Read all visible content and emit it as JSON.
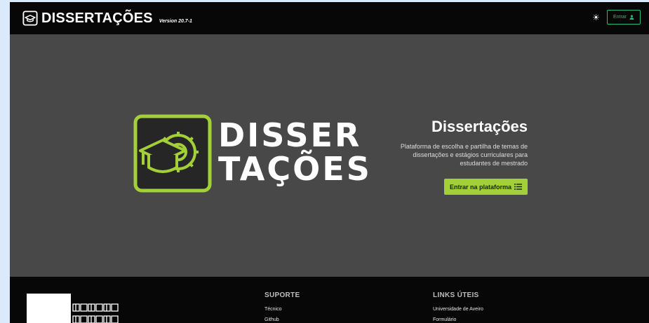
{
  "header": {
    "brand_title": "DISSERTAÇÕES",
    "version": "Version 20.7-1",
    "theme_toggle_icon": "sun-icon",
    "login_label": "Entrar",
    "login_icon": "user-icon"
  },
  "hero": {
    "wordmark_line1": "DISSER",
    "wordmark_line2": "TAÇÕES",
    "title": "Dissertações",
    "description": "Plataforma de escolha e partilha de temas de dissertações e estágios curriculares para estudantes de mestrado",
    "cta_label": "Entrar na plataforma",
    "cta_icon": "list-icon"
  },
  "footer": {
    "support": {
      "heading": "SUPORTE",
      "links": [
        "Técnico",
        "Github"
      ]
    },
    "useful_links": {
      "heading": "LINKS ÚTEIS",
      "links": [
        "Universidade de Aveiro",
        "Formulário"
      ]
    }
  },
  "colors": {
    "accent_green": "#a3d039",
    "login_green": "#21c07a",
    "hero_bg": "#484848",
    "bar_bg": "#070707",
    "outer_bg": "#dbeafa"
  }
}
